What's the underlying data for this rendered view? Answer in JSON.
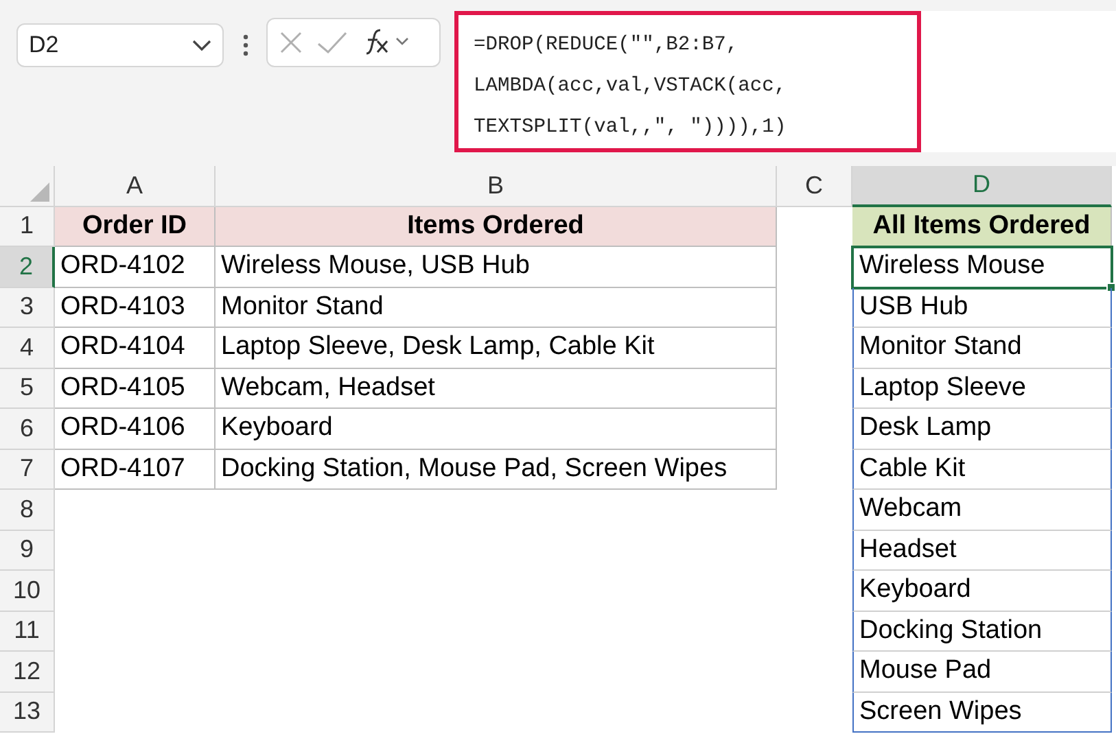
{
  "name_box": {
    "value": "D2"
  },
  "formula_bar": {
    "lines": [
      "=DROP(REDUCE(\"\",B2:B7,",
      "LAMBDA(acc,val,VSTACK(acc,",
      "TEXTSPLIT(val,,\", \")))),1)"
    ]
  },
  "columns": [
    {
      "label": "A",
      "selected": false
    },
    {
      "label": "B",
      "selected": false
    },
    {
      "label": "C",
      "selected": false
    },
    {
      "label": "D",
      "selected": true
    }
  ],
  "rows": [
    {
      "number": "1",
      "selected": false,
      "cells": [
        {
          "kind": "header",
          "text": "Order ID",
          "color": "#f2dcdb"
        },
        {
          "kind": "header",
          "text": "Items Ordered",
          "color": "#f2dcdb"
        },
        {
          "kind": "empty"
        },
        {
          "kind": "header",
          "text": "All Items Ordered",
          "color": "#d8e4bc"
        }
      ]
    },
    {
      "number": "2",
      "selected": true,
      "cells": [
        {
          "kind": "text",
          "text": "ORD-4102"
        },
        {
          "kind": "text",
          "text": "Wireless Mouse, USB Hub"
        },
        {
          "kind": "empty"
        },
        {
          "kind": "spill",
          "text": "Wireless Mouse",
          "selected": true
        }
      ]
    },
    {
      "number": "3",
      "selected": false,
      "cells": [
        {
          "kind": "text",
          "text": "ORD-4103"
        },
        {
          "kind": "text",
          "text": "Monitor Stand"
        },
        {
          "kind": "empty"
        },
        {
          "kind": "spill",
          "text": "USB Hub",
          "selected": false
        }
      ]
    },
    {
      "number": "4",
      "selected": false,
      "cells": [
        {
          "kind": "text",
          "text": "ORD-4104"
        },
        {
          "kind": "text",
          "text": "Laptop Sleeve, Desk Lamp, Cable Kit"
        },
        {
          "kind": "empty"
        },
        {
          "kind": "spill",
          "text": "Monitor Stand",
          "selected": false
        }
      ]
    },
    {
      "number": "5",
      "selected": false,
      "cells": [
        {
          "kind": "text",
          "text": "ORD-4105"
        },
        {
          "kind": "text",
          "text": "Webcam, Headset"
        },
        {
          "kind": "empty"
        },
        {
          "kind": "spill",
          "text": "Laptop Sleeve",
          "selected": false
        }
      ]
    },
    {
      "number": "6",
      "selected": false,
      "cells": [
        {
          "kind": "text",
          "text": "ORD-4106"
        },
        {
          "kind": "text",
          "text": "Keyboard"
        },
        {
          "kind": "empty"
        },
        {
          "kind": "spill",
          "text": "Desk Lamp",
          "selected": false
        }
      ]
    },
    {
      "number": "7",
      "selected": false,
      "cells": [
        {
          "kind": "text",
          "text": "ORD-4107"
        },
        {
          "kind": "text",
          "text": "Docking Station, Mouse Pad, Screen Wipes"
        },
        {
          "kind": "empty"
        },
        {
          "kind": "spill",
          "text": "Cable Kit",
          "selected": false
        }
      ]
    },
    {
      "number": "8",
      "selected": false,
      "cells": [
        {
          "kind": "empty"
        },
        {
          "kind": "empty"
        },
        {
          "kind": "empty"
        },
        {
          "kind": "spill",
          "text": "Webcam",
          "selected": false
        }
      ]
    },
    {
      "number": "9",
      "selected": false,
      "cells": [
        {
          "kind": "empty"
        },
        {
          "kind": "empty"
        },
        {
          "kind": "empty"
        },
        {
          "kind": "spill",
          "text": "Headset",
          "selected": false
        }
      ]
    },
    {
      "number": "10",
      "selected": false,
      "cells": [
        {
          "kind": "empty"
        },
        {
          "kind": "empty"
        },
        {
          "kind": "empty"
        },
        {
          "kind": "spill",
          "text": "Keyboard",
          "selected": false
        }
      ]
    },
    {
      "number": "11",
      "selected": false,
      "cells": [
        {
          "kind": "empty"
        },
        {
          "kind": "empty"
        },
        {
          "kind": "empty"
        },
        {
          "kind": "spill",
          "text": "Docking Station",
          "selected": false
        }
      ]
    },
    {
      "number": "12",
      "selected": false,
      "cells": [
        {
          "kind": "empty"
        },
        {
          "kind": "empty"
        },
        {
          "kind": "empty"
        },
        {
          "kind": "spill",
          "text": "Mouse Pad",
          "selected": false
        }
      ]
    },
    {
      "number": "13",
      "selected": false,
      "cells": [
        {
          "kind": "empty"
        },
        {
          "kind": "empty"
        },
        {
          "kind": "empty"
        },
        {
          "kind": "spill",
          "text": "Screen Wipes",
          "selected": false
        }
      ]
    }
  ]
}
